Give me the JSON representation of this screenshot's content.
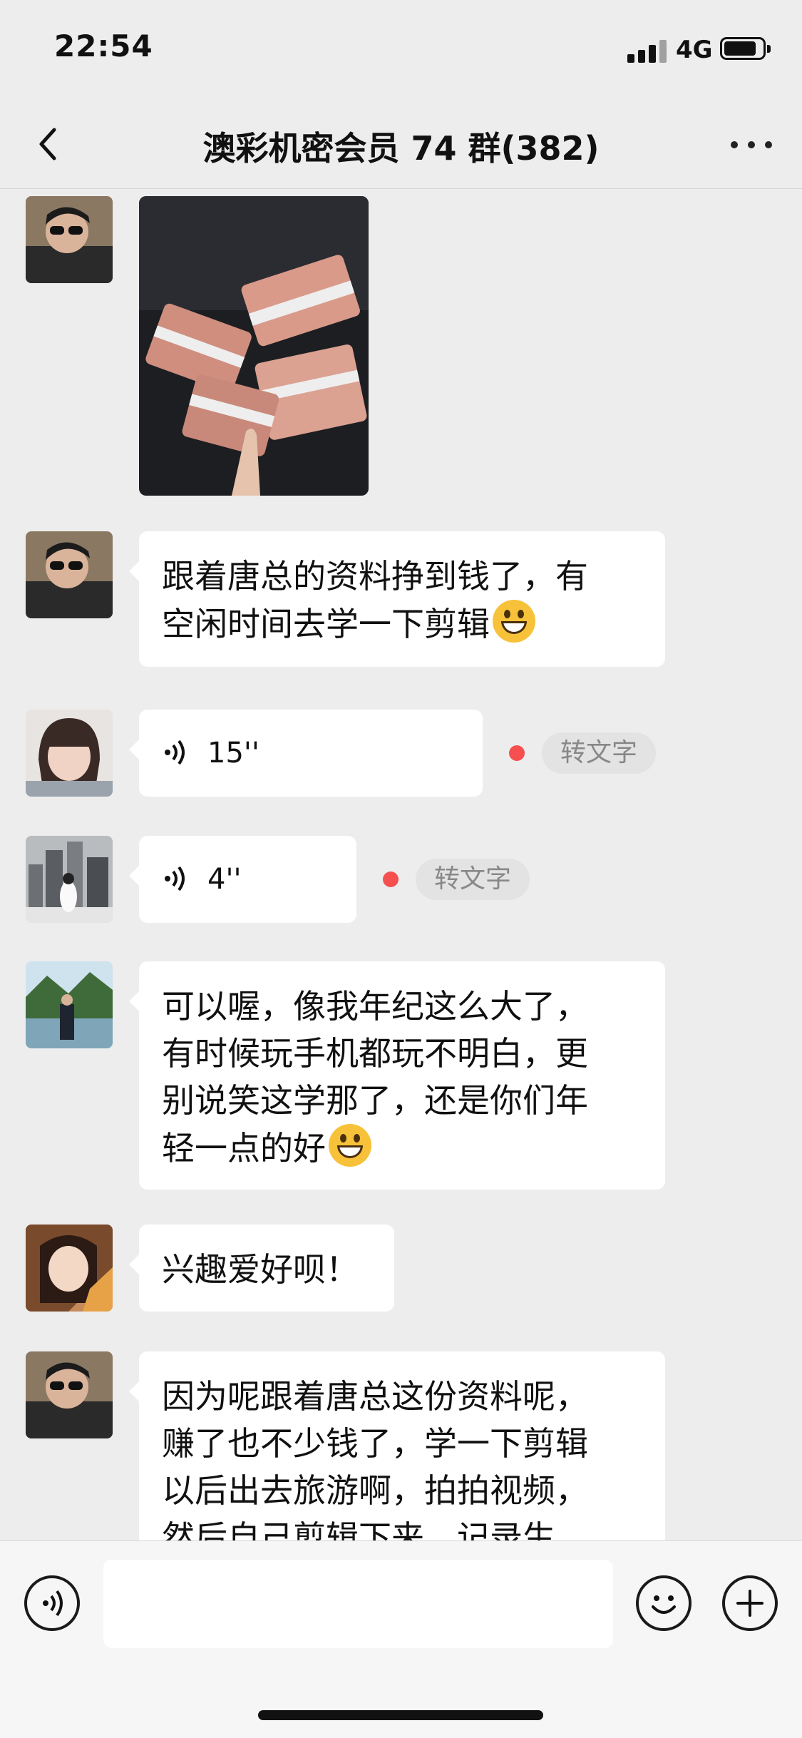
{
  "status_bar": {
    "time": "22:54",
    "network": "4G"
  },
  "header": {
    "title": "澳彩机密会员 74 群(382)"
  },
  "messages": [
    {
      "type": "image",
      "avatar_icon": "avatar-man-sunglasses-icon",
      "image_icon": "photo-cash-stacks-icon"
    },
    {
      "type": "text",
      "avatar_icon": "avatar-man-sunglasses-icon",
      "lines": [
        "跟着唐总的资料挣到钱了，有",
        "空闲时间去学一下剪辑"
      ],
      "emoji": "grin-emoji-icon"
    },
    {
      "type": "voice",
      "avatar_icon": "avatar-child-icon",
      "duration": "15''",
      "to_text_label": "转文字"
    },
    {
      "type": "voice",
      "avatar_icon": "avatar-city-icon",
      "duration": "4''",
      "to_text_label": "转文字"
    },
    {
      "type": "text",
      "avatar_icon": "avatar-landscape-man-icon",
      "lines": [
        "可以喔，像我年纪这么大了，",
        "有时候玩手机都玩不明白，更",
        "别说笑这学那了，还是你们年",
        "轻一点的好"
      ],
      "emoji": "smile-emoji-icon"
    },
    {
      "type": "text",
      "avatar_icon": "avatar-woman-icon",
      "lines": [
        "兴趣爱好呗！"
      ]
    },
    {
      "type": "text",
      "avatar_icon": "avatar-man-sunglasses-icon",
      "lines": [
        "因为呢跟着唐总这份资料呢，",
        "赚了也不少钱了，学一下剪辑",
        "以后出去旅游啊，拍拍视频，",
        "然后自己剪辑下来，记录生"
      ]
    }
  ],
  "input_bar": {
    "value": "",
    "placeholder": ""
  },
  "colors": {
    "background": "#ededed",
    "bubble": "#ffffff",
    "unread_dot": "#f5504f"
  }
}
